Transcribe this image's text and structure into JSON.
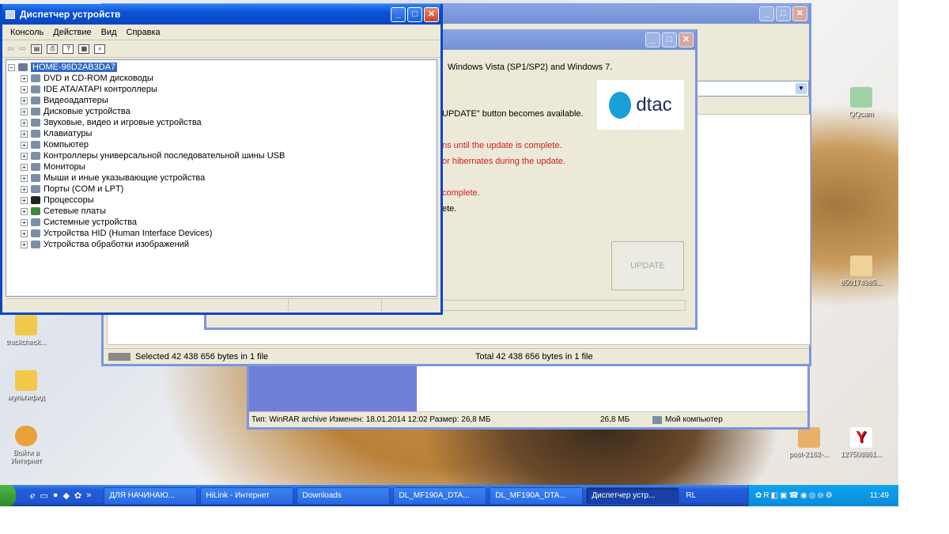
{
  "desktop_icons": [
    {
      "label": "QQcam",
      "icon": "qq-icon"
    },
    {
      "label": "850174985...",
      "icon": "file-icon"
    },
    {
      "label": "trackcheck...",
      "icon": "folder-icon"
    },
    {
      "label": "мультифид",
      "icon": "folder-icon"
    },
    {
      "label": "Войти в Интернет",
      "icon": "internet-icon"
    },
    {
      "label": "post-2162-...",
      "icon": "archive-icon"
    },
    {
      "label": "127508861...",
      "icon": "yandex-icon"
    }
  ],
  "winrar": {
    "status_left": "Selected 42 438 656 bytes in 1 file",
    "status_right": "Total 42 438 656 bytes in 1 file"
  },
  "explorer": {
    "status_type": "Тип: WinRAR archive Изменен: 18.01.2014 12:02 Размер: 26,8 МБ",
    "status_size": "26,8 МБ",
    "status_location": "Мой компьютер"
  },
  "updater": {
    "lines": [
      "Windows Vista (SP1/SP2) and Windows 7.",
      "UPDATE\" button becomes available.",
      "ns until the update is complete.",
      "or hibernates during the update.",
      "complete.",
      "ete."
    ],
    "logo_text": "dtac",
    "update_button": "UPDATE"
  },
  "device_manager": {
    "title": "Диспетчер устройств",
    "menu": [
      "Консоль",
      "Действие",
      "Вид",
      "Справка"
    ],
    "root": "HOME-96D2AB3DA7",
    "items": [
      "DVD и CD-ROM дисководы",
      "IDE ATA/ATAPI контроллеры",
      "Видеоадаптеры",
      "Дисковые устройства",
      "Звуковые, видео и игровые устройства",
      "Клавиатуры",
      "Компьютер",
      "Контроллеры универсальной последовательной шины USB",
      "Мониторы",
      "Мыши и иные указывающие устройства",
      "Порты (COM и LPT)",
      "Процессоры",
      "Сетевые платы",
      "Системные устройства",
      "Устройства HID (Human Interface Devices)",
      "Устройства обработки изображений"
    ]
  },
  "taskbar": {
    "tasks": [
      "ДЛЯ НАЧИНАЮ...",
      "HiLink - Интернет",
      "Downloads",
      "DL_MF190A_DTA...",
      "DL_MF190A_DTA...",
      "Диспетчер устр..."
    ],
    "lang": "RL",
    "time": "11:49"
  }
}
